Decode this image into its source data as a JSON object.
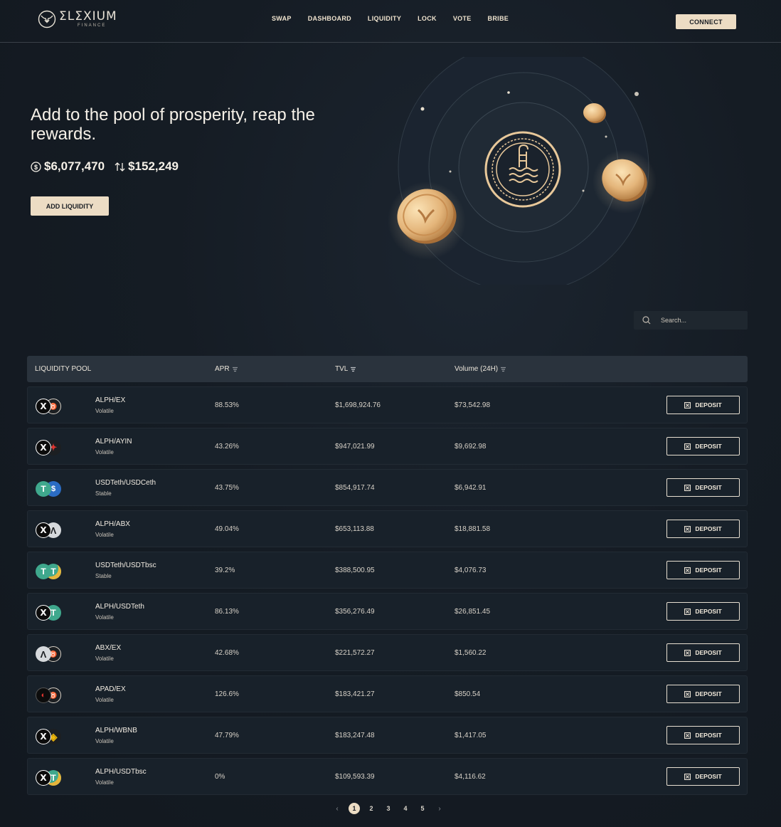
{
  "header": {
    "logo_name": "ΣLΣXIUM",
    "logo_sub": "FINANCE",
    "nav": [
      "SWAP",
      "DASHBOARD",
      "LIQUIDITY",
      "LOCK",
      "VOTE",
      "BRIBE"
    ],
    "connect_label": "CONNECT"
  },
  "hero": {
    "title": "Add to the pool of prosperity, reap the rewards.",
    "tvl": "$6,077,470",
    "volume": "$152,249",
    "add_liquidity_label": "ADD LIQUIDITY"
  },
  "search": {
    "placeholder": "Search..."
  },
  "table": {
    "headers": {
      "pool": "LIQUIDITY POOL",
      "apr": "APR",
      "tvl": "TVL",
      "volume": "Volume (24H)"
    },
    "deposit_label": "DEPOSIT",
    "rows": [
      {
        "name": "ALPH/EX",
        "type": "Volatile",
        "apr": "88.53%",
        "tvl": "$1,698,924.76",
        "volume": "$73,542.98",
        "icons": [
          "alph-icon",
          "ex-icon"
        ]
      },
      {
        "name": "ALPH/AYIN",
        "type": "Volatile",
        "apr": "43.26%",
        "tvl": "$947,021.99",
        "volume": "$9,692.98",
        "icons": [
          "alph-icon",
          "ayin-icon"
        ]
      },
      {
        "name": "USDTeth/USDCeth",
        "type": "Stable",
        "apr": "43.75%",
        "tvl": "$854,917.74",
        "volume": "$6,942.91",
        "icons": [
          "usdt-icon",
          "usdc-icon"
        ]
      },
      {
        "name": "ALPH/ABX",
        "type": "Volatile",
        "apr": "49.04%",
        "tvl": "$653,113.88",
        "volume": "$18,881.58",
        "icons": [
          "alph-icon",
          "abx-icon"
        ]
      },
      {
        "name": "USDTeth/USDTbsc",
        "type": "Stable",
        "apr": "39.2%",
        "tvl": "$388,500.95",
        "volume": "$4,076.73",
        "icons": [
          "usdt-icon",
          "usdt-bsc-icon"
        ]
      },
      {
        "name": "ALPH/USDTeth",
        "type": "Volatile",
        "apr": "86.13%",
        "tvl": "$356,276.49",
        "volume": "$26,851.45",
        "icons": [
          "alph-icon",
          "usdt-icon"
        ]
      },
      {
        "name": "ABX/EX",
        "type": "Volatile",
        "apr": "42.68%",
        "tvl": "$221,572.27",
        "volume": "$1,560.22",
        "icons": [
          "abx-icon",
          "ex-icon"
        ]
      },
      {
        "name": "APAD/EX",
        "type": "Volatile",
        "apr": "126.6%",
        "tvl": "$183,421.27",
        "volume": "$850.54",
        "icons": [
          "apad-icon",
          "ex-icon"
        ]
      },
      {
        "name": "ALPH/WBNB",
        "type": "Volatile",
        "apr": "47.79%",
        "tvl": "$183,247.48",
        "volume": "$1,417.05",
        "icons": [
          "alph-icon",
          "bnb-icon"
        ]
      },
      {
        "name": "ALPH/USDTbsc",
        "type": "Volatile",
        "apr": "0%",
        "tvl": "$109,593.39",
        "volume": "$4,116.62",
        "icons": [
          "alph-icon",
          "usdt-bsc-icon"
        ]
      }
    ]
  },
  "pagination": {
    "pages": [
      "1",
      "2",
      "3",
      "4",
      "5"
    ],
    "active": "1"
  },
  "colors": {
    "accent": "#ecdcc4",
    "background": "#151c24",
    "row": "#18212a",
    "header_row": "#2a333d"
  }
}
